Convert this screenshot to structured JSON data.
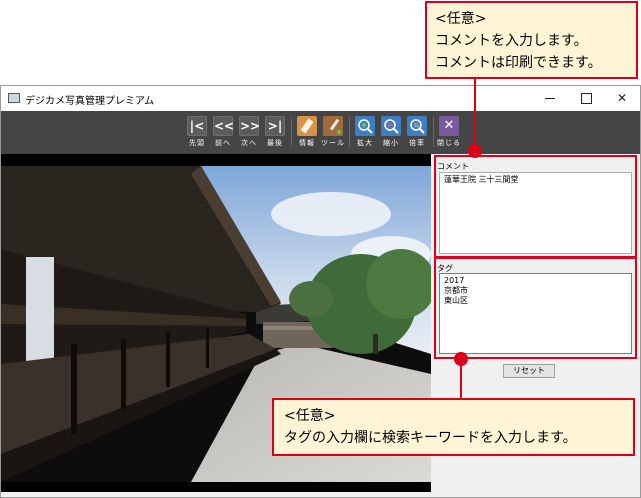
{
  "callouts": {
    "top": {
      "lines": [
        "<任意>",
        "コメントを入力します。",
        "コメントは印刷できます。"
      ]
    },
    "bottom": {
      "lines": [
        "<任意>",
        "タグの入力欄に検索キーワードを入力します。"
      ]
    }
  },
  "window": {
    "title": "デジカメ写真管理プレミアム",
    "controls": {
      "minimize": "minimize",
      "maximize": "maximize",
      "close": "✕"
    }
  },
  "toolbar": {
    "buttons": [
      {
        "glyph": "|<",
        "label": "先頭"
      },
      {
        "glyph": "<<",
        "label": "前へ"
      },
      {
        "glyph": ">>",
        "label": "次へ"
      },
      {
        "glyph": ">|",
        "label": "最後"
      },
      {
        "glyph": "",
        "label": "情報"
      },
      {
        "glyph": "",
        "label": "ツール"
      },
      {
        "glyph": "",
        "label": "拡大"
      },
      {
        "glyph": "",
        "label": "縮小"
      },
      {
        "glyph": "",
        "label": "倍率"
      },
      {
        "glyph": "✕",
        "label": "閉じる"
      }
    ]
  },
  "side": {
    "comment_label": "コメント",
    "comment_text": "蓮華王院 三十三間堂",
    "tag_label": "タグ",
    "tag_lines": [
      "2017",
      "京都市",
      "東山区"
    ],
    "reset_label": "リセット"
  },
  "colors": {
    "accent_red": "#d9001b",
    "callout_bg": "#fff4d6",
    "toolbar_bg": "#454545"
  }
}
